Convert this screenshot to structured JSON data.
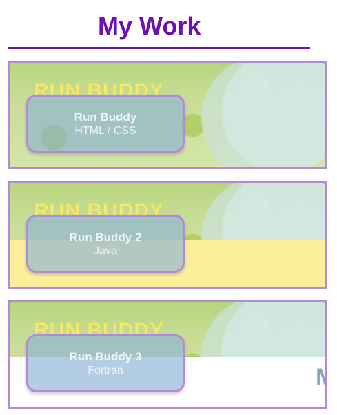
{
  "section": {
    "title": "My Work"
  },
  "projects": [
    {
      "brand": "RUN BUDDY",
      "name": "Run Buddy",
      "tech": "HTML / CSS"
    },
    {
      "brand": "RUN BUDDY",
      "name": "Run Buddy 2",
      "tech": "Java"
    },
    {
      "brand": "RUN BUDDY",
      "name": "Run Buddy 3",
      "tech": "Fortran",
      "strip_text": "M"
    }
  ],
  "colors": {
    "accent": "#6d0fb4",
    "card_border": "#b48ad8",
    "overlay_fill": "#8ab2d6",
    "brand_text": "#f2e86a",
    "strip_yellow": "#fcef9a"
  }
}
